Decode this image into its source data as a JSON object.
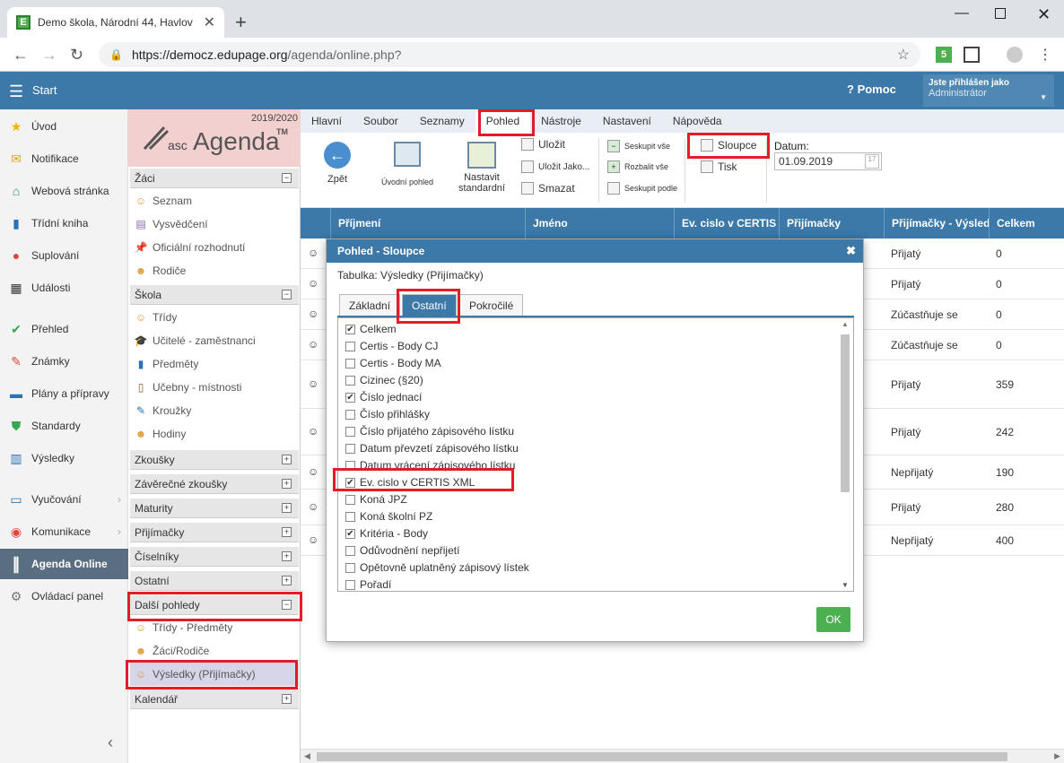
{
  "browser": {
    "tab_title": "Demo škola, Národní 44, Havlov",
    "url_host": "https://democz.edupage.org",
    "url_path": "/agenda/online.php?",
    "extension_label": "5"
  },
  "header": {
    "start_label": "Start",
    "help_label": "Pomoc",
    "user_line1": "Jste přihlášen jako",
    "user_line2": "Administrátor"
  },
  "leftnav": [
    {
      "label": "Úvod",
      "icon": "star-icon"
    },
    {
      "label": "Notifikace",
      "icon": "envelope-icon"
    },
    {
      "label": "Webová stránka",
      "icon": "house-icon"
    },
    {
      "label": "Třídní kniha",
      "icon": "book-icon"
    },
    {
      "label": "Suplování",
      "icon": "person-icon"
    },
    {
      "label": "Události",
      "icon": "calendar-icon"
    },
    {
      "label": "Přehled",
      "icon": "check-circle-icon"
    },
    {
      "label": "Známky",
      "icon": "grade-icon"
    },
    {
      "label": "Plány a přípravy",
      "icon": "briefcase-icon"
    },
    {
      "label": "Standardy",
      "icon": "shield-check-icon"
    },
    {
      "label": "Výsledky",
      "icon": "bar-chart-icon"
    },
    {
      "label": "Vyučování",
      "icon": "open-book-icon"
    },
    {
      "label": "Komunikace",
      "icon": "chat-icon"
    },
    {
      "label": "Agenda Online",
      "icon": "agenda-icon"
    },
    {
      "label": "Ovládací panel",
      "icon": "gear-icon"
    }
  ],
  "agenda": {
    "year": "2019/2020",
    "logo_asc": "asc",
    "logo_big": "Agenda",
    "logo_tm": "TM",
    "sections": [
      {
        "label": "Žáci",
        "sign": "−"
      },
      {
        "label": "Škola",
        "sign": "−"
      },
      {
        "label": "Zkoušky",
        "sign": "+"
      },
      {
        "label": "Závěrečné zkoušky",
        "sign": "+"
      },
      {
        "label": "Maturity",
        "sign": "+"
      },
      {
        "label": "Přijímačky",
        "sign": "+"
      },
      {
        "label": "Číselníky",
        "sign": "+"
      },
      {
        "label": "Ostatní",
        "sign": "+"
      },
      {
        "label": "Další pohledy",
        "sign": "−"
      },
      {
        "label": "Kalendář",
        "sign": "+"
      }
    ],
    "items": {
      "zaci": [
        "Seznam",
        "Vysvědčení",
        "Oficiální rozhodnutí",
        "Rodiče"
      ],
      "skola": [
        "Třídy",
        "Učitelé - zaměstnanci",
        "Předměty",
        "Učebny - místnosti",
        "Kroužky",
        "Hodiny"
      ],
      "dalsi": [
        "Třídy - Předměty",
        "Žáci/Rodiče",
        "Výsledky (Přijímačky)"
      ]
    }
  },
  "menubar": [
    "Hlavní",
    "Soubor",
    "Seznamy",
    "Pohled",
    "Nástroje",
    "Nastavení",
    "Nápověda"
  ],
  "ribbon": {
    "back": "Zpět",
    "default_view": "Úvodní pohled",
    "set_standard_1": "Nastavit",
    "set_standard_2": "standardní",
    "save": "Uložit",
    "save_as": "Uložit Jako...",
    "delete": "Smazat",
    "group_all": "Seskupit vše",
    "expand_all": "Rozbalit vše",
    "group_by": "Seskupit podle",
    "columns": "Sloupce",
    "print": "Tisk",
    "date_label": "Datum:",
    "date_value": "01.09.2019"
  },
  "table": {
    "columns": [
      "Příjmení",
      "Jméno",
      "Ev. cislo v CERTIS",
      "Přijímačky",
      "Přijímačky - Výsled",
      "Celkem"
    ],
    "rows": [
      {
        "result": "Přijatý",
        "total": "0"
      },
      {
        "result": "Přijatý",
        "total": "0"
      },
      {
        "result": "Zúčastňuje se",
        "total": "0"
      },
      {
        "result": "Zúčastňuje se",
        "total": "0"
      },
      {
        "result": "Přijatý",
        "total": "359"
      },
      {
        "result": "Přijatý",
        "total": "242"
      },
      {
        "result": "Nepřijatý",
        "total": "190"
      },
      {
        "result": "Přijatý",
        "total": "280"
      },
      {
        "result": "Nepřijatý",
        "total": "400"
      }
    ]
  },
  "dialog": {
    "title": "Pohled - Sloupce",
    "subtitle": "Tabulka: Výsledky (Přijímačky)",
    "tabs": [
      "Základní",
      "Ostatní",
      "Pokročilé"
    ],
    "checkboxes": [
      {
        "label": "Celkem",
        "checked": true
      },
      {
        "label": "Certis - Body CJ",
        "checked": false
      },
      {
        "label": "Certis - Body MA",
        "checked": false
      },
      {
        "label": "Cizinec (§20)",
        "checked": false
      },
      {
        "label": "Číslo jednací",
        "checked": true
      },
      {
        "label": "Číslo přihlášky",
        "checked": false
      },
      {
        "label": "Číslo přijatého zápisového lístku",
        "checked": false
      },
      {
        "label": "Datum převzetí zápisového lístku",
        "checked": false
      },
      {
        "label": "Datum vrácení zápisového lístku",
        "checked": false
      },
      {
        "label": "Ev. cislo v CERTIS XML",
        "checked": true
      },
      {
        "label": "Koná JPZ",
        "checked": false
      },
      {
        "label": "Koná školní PZ",
        "checked": false
      },
      {
        "label": "Kritéria - Body",
        "checked": true
      },
      {
        "label": "Odůvodnění nepřijetí",
        "checked": false
      },
      {
        "label": "Opětovně uplatněný zápisový lístek",
        "checked": false
      },
      {
        "label": "Pořadí",
        "checked": false
      }
    ],
    "ok_label": "OK"
  },
  "colors": {
    "primary": "#3c78a8",
    "highlight": "#e21c28",
    "ok": "#4caf50"
  }
}
